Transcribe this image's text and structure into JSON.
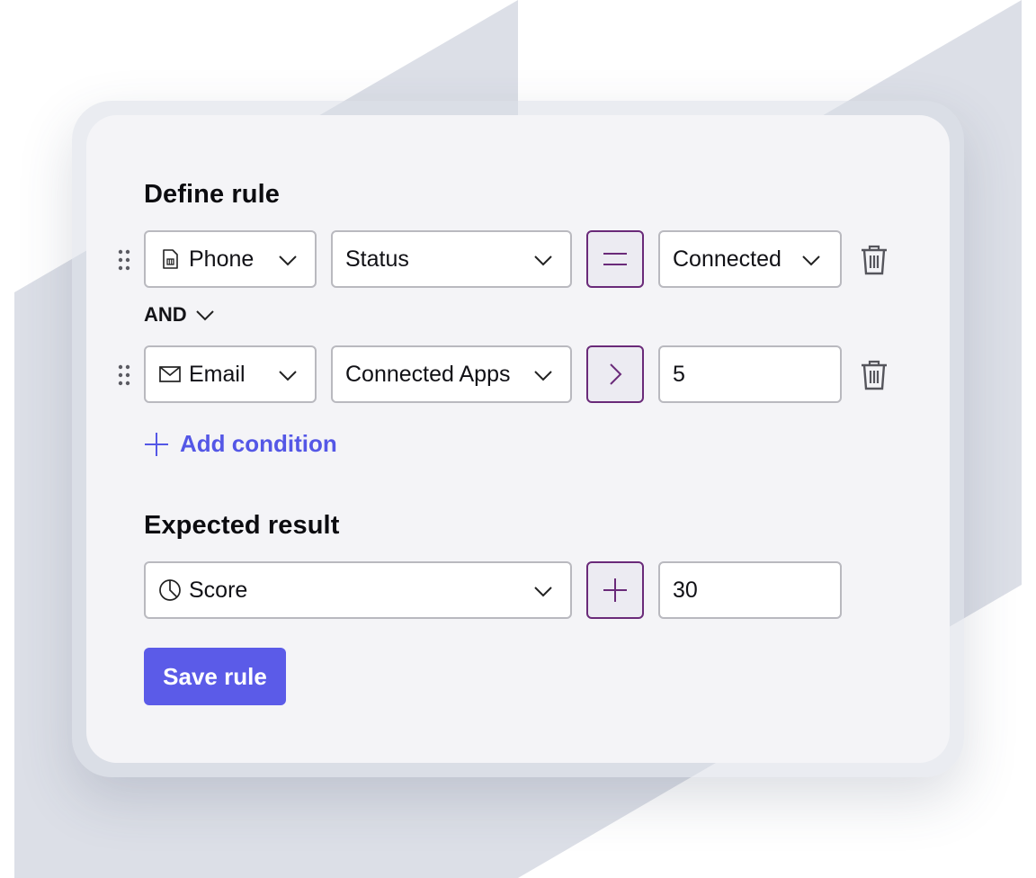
{
  "colors": {
    "accent": "#5b5be8",
    "operator_border": "#6a2a79",
    "card_background": "#f4f4f7",
    "backdrop_shape": "#dcdfe7"
  },
  "define_rule": {
    "title": "Define rule",
    "conditions": [
      {
        "source": {
          "label": "Phone",
          "icon": "sim-card-icon"
        },
        "property": "Status",
        "operator": {
          "icon": "equals-icon"
        },
        "value": "Connected"
      },
      {
        "source": {
          "label": "Email",
          "icon": "envelope-icon"
        },
        "property": "Connected Apps",
        "operator": {
          "icon": "greater-than-icon"
        },
        "value": "5"
      }
    ],
    "connector": "AND",
    "add_condition": "Add condition"
  },
  "expected_result": {
    "title": "Expected result",
    "metric": {
      "label": "Score",
      "icon": "pie-chart-icon"
    },
    "operator": {
      "icon": "plus-icon"
    },
    "value": "30"
  },
  "save_button": "Save rule"
}
